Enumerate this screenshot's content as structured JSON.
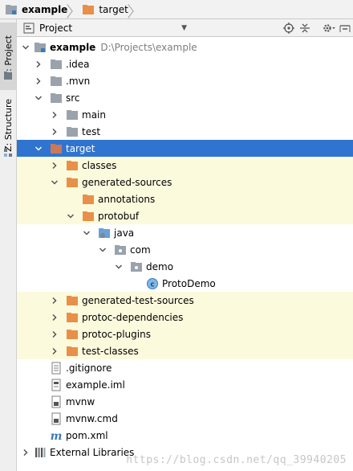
{
  "breadcrumb": {
    "items": [
      "example",
      "target"
    ]
  },
  "sidebar": {
    "tabs": [
      "1: Project",
      "Z: Structure"
    ]
  },
  "panel": {
    "title": "Project"
  },
  "colors": {
    "selection": "#2f74d0",
    "highlight_row": "#fcfadd",
    "folder_orange": "#e8904a",
    "folder_gray": "#9aa3ab"
  },
  "tree": {
    "root": {
      "name": "example",
      "path": "D:\\Projects\\example"
    },
    "items": {
      "idea": ".idea",
      "mvn": ".mvn",
      "src": "src",
      "main": "main",
      "test": "test",
      "target": "target",
      "classes": "classes",
      "generated_sources": "generated-sources",
      "annotations": "annotations",
      "protobuf": "protobuf",
      "java": "java",
      "com": "com",
      "demo": "demo",
      "protodemo": "ProtoDemo",
      "generated_test_sources": "generated-test-sources",
      "protoc_dependencies": "protoc-dependencies",
      "protoc_plugins": "protoc-plugins",
      "test_classes": "test-classes",
      "gitignore": ".gitignore",
      "example_iml": "example.iml",
      "mvnw": "mvnw",
      "mvnw_cmd": "mvnw.cmd",
      "pom": "pom.xml",
      "external": "External Libraries"
    }
  },
  "watermark": "https://blog.csdn.net/qq_39940205"
}
